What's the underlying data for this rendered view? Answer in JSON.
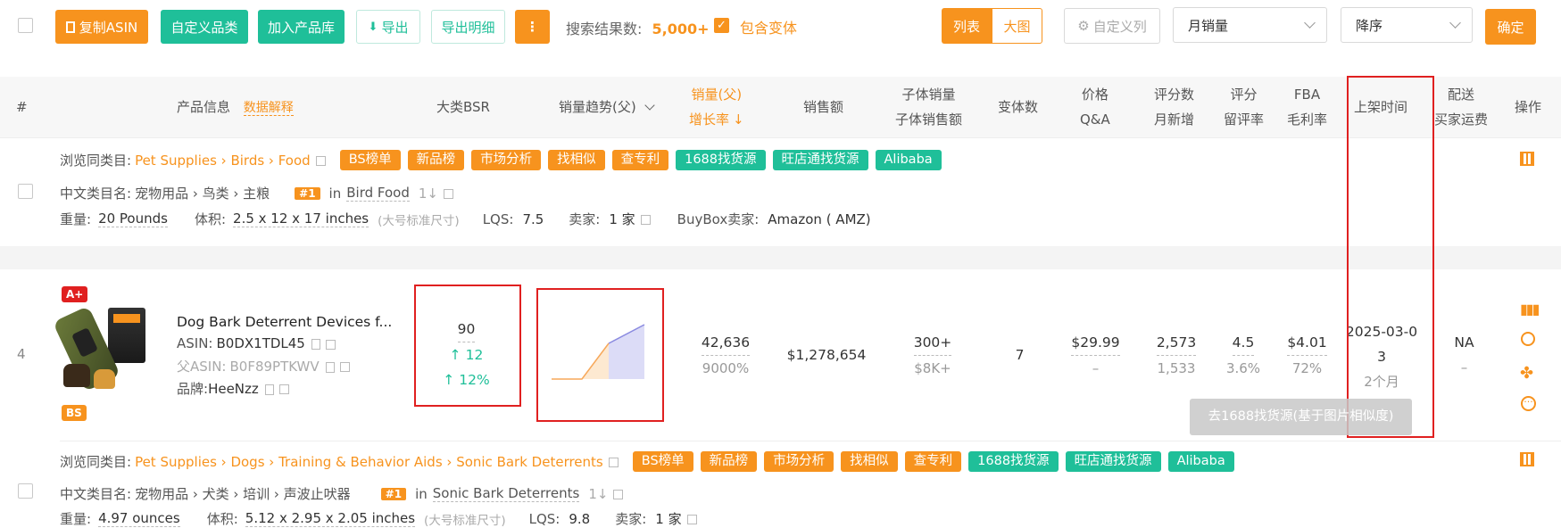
{
  "toolbar": {
    "copy_asin": "复制ASIN",
    "custom_category": "自定义品类",
    "add_to_library": "加入产品库",
    "export": "导出",
    "export_detail": "导出明细",
    "more": "⋮",
    "result_label": "搜索结果数:",
    "result_count": "5,000+",
    "include_variants": "包含变体",
    "view_list": "列表",
    "view_grid": "大图",
    "custom_columns": "自定义列",
    "sort_field": "月销量",
    "sort_order": "降序",
    "confirm": "确定"
  },
  "table_header": {
    "index": "#",
    "product_info": "产品信息",
    "data_explain": "数据解释",
    "bsr": "大类BSR",
    "sales_trend": "销量趋势(父)",
    "sales_parent": "销量(父)",
    "growth_rate": "增长率",
    "revenue": "销售额",
    "child_sales": "子体销量",
    "child_revenue": "子体销售额",
    "variants": "变体数",
    "price": "价格",
    "qa": "Q&A",
    "ratings": "评分数",
    "monthly_new": "月新增",
    "rating": "评分",
    "review_rate": "留评率",
    "fba": "FBA",
    "margin": "毛利率",
    "listing_date": "上架时间",
    "delivery": "配送",
    "buyer_shipping": "买家运费",
    "actions": "操作"
  },
  "row_top": {
    "browse_label": "浏览同类目:",
    "path": [
      "Pet Supplies",
      "Birds",
      "Food"
    ],
    "tags_orange": [
      "BS榜单",
      "新品榜",
      "市场分析",
      "找相似",
      "查专利"
    ],
    "tags_green": [
      "1688找货源",
      "旺店通找货源",
      "Alibaba"
    ],
    "cn_cat_label": "中文类目名:",
    "cn_cat": "宠物用品 › 鸟类 › 主粮",
    "rank_badge": "#1",
    "rank_in": "in",
    "rank_cat": "Bird Food",
    "weight_label": "重量:",
    "weight": "20 Pounds",
    "volume_label": "体积:",
    "volume": "2.5 x 12 x 17 inches",
    "size_note": "(大号标准尺寸)",
    "lqs_label": "LQS:",
    "lqs": "7.5",
    "seller_label": "卖家:",
    "seller": "1 家",
    "buybox_label": "BuyBox卖家:",
    "buybox": "Amazon ( AMZ)"
  },
  "row4": {
    "index": "4",
    "badge_aplus": "A+",
    "badge_bs": "BS",
    "title": "Dog Bark Deterrent Devices f...",
    "asin_label": "ASIN:",
    "asin": "B0DX1TDL45",
    "parent_label": "父ASIN:",
    "parent_asin": "B0F89PTKWV",
    "brand_label": "品牌:",
    "brand": "HeeNzz",
    "bsr": "90",
    "bsr_change": "↑ 12",
    "bsr_pct": "↑ 12%",
    "sales": "42,636",
    "growth": "9000%",
    "revenue": "$1,278,654",
    "child_sales": "300+",
    "child_revenue": "$8K+",
    "variants": "7",
    "price": "$29.99",
    "qa": "–",
    "ratings": "2,573",
    "monthly_new": "1,533",
    "rating": "4.5",
    "review_rate": "3.6%",
    "fba": "$4.01",
    "margin": "72%",
    "listing_date": "2025-03-03",
    "listing_ago": "2个月",
    "delivery": "NA",
    "shipping": "–",
    "tooltip": "去1688找货源(基于图片相似度)"
  },
  "row_bottom": {
    "browse_label": "浏览同类目:",
    "path": [
      "Pet Supplies",
      "Dogs",
      "Training & Behavior Aids",
      "Sonic Bark Deterrents"
    ],
    "tags_orange": [
      "BS榜单",
      "新品榜",
      "市场分析",
      "找相似",
      "查专利"
    ],
    "tags_green": [
      "1688找货源",
      "旺店通找货源",
      "Alibaba"
    ],
    "cn_cat_label": "中文类目名:",
    "cn_cat": "宠物用品 › 犬类 › 培训 › 声波止吠器",
    "rank_badge": "#1",
    "rank_in": "in",
    "rank_cat": "Sonic Bark Deterrents",
    "weight_label": "重量:",
    "weight": "4.97 ounces",
    "volume_label": "体积:",
    "volume": "5.12 x 2.95 x 2.05 inches",
    "size_note": "(大号标准尺寸)",
    "lqs_label": "LQS:",
    "lqs": "9.8",
    "seller_label": "卖家:",
    "seller": "1 家"
  },
  "colors": {
    "orange": "#f7931e",
    "green": "#1fbf99",
    "red_box": "#e02020"
  }
}
